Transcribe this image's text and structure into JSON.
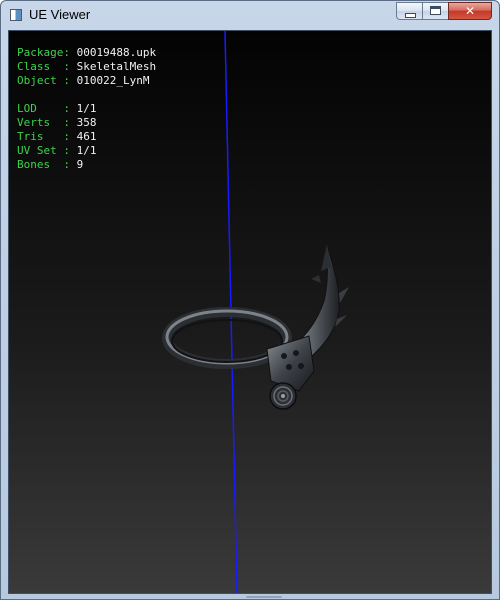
{
  "window": {
    "title": "UE Viewer",
    "close_glyph": "✕"
  },
  "info": {
    "package": {
      "key": "Package:",
      "value": "00019488.upk"
    },
    "class": {
      "key": "Class  :",
      "value": "SkeletalMesh"
    },
    "object": {
      "key": "Object :",
      "value": "010022_LynM"
    },
    "lod": {
      "key": "LOD    :",
      "value": "1/1"
    },
    "verts": {
      "key": "Verts  :",
      "value": "358"
    },
    "tris": {
      "key": "Tris   :",
      "value": "461"
    },
    "uvset": {
      "key": "UV Set :",
      "value": "1/1"
    },
    "bones": {
      "key": "Bones  :",
      "value": "9"
    }
  },
  "colors": {
    "label_green": "#3cd34c",
    "value_white": "#f2f2f2",
    "axis_blue": "#1a1aff"
  },
  "icons": {
    "app": "app-icon",
    "minimize": "minimize-icon",
    "maximize": "maximize-icon",
    "close": "close-icon"
  }
}
